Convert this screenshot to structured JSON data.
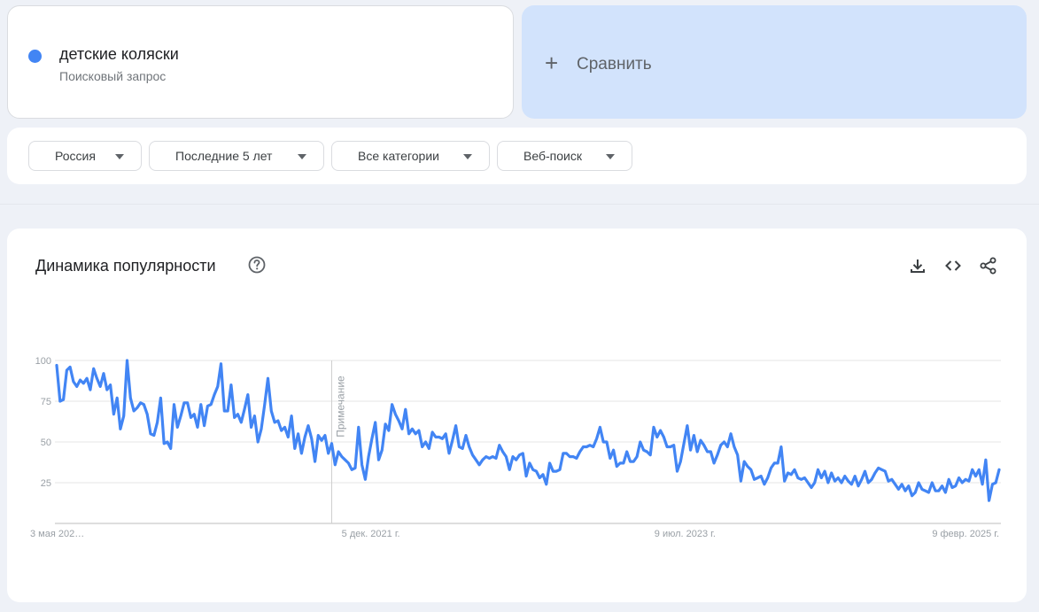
{
  "term": {
    "title": "детские коляски",
    "subtitle": "Поисковый запрос",
    "color": "#4285f4"
  },
  "compare": {
    "label": "Сравнить",
    "icon": "plus-icon"
  },
  "filters": [
    {
      "label": "Россия"
    },
    {
      "label": "Последние 5 лет"
    },
    {
      "label": "Все категории"
    },
    {
      "label": "Веб-поиск"
    }
  ],
  "chart_card": {
    "title": "Динамика популярности",
    "icons": [
      "help-icon",
      "download-icon",
      "embed-icon",
      "share-icon"
    ]
  },
  "chart_data": {
    "type": "line",
    "x_tick_labels": [
      "3 мая 202…",
      "5 дек. 2021 г.",
      "9 июл. 2023 г.",
      "9 февр. 2025 г."
    ],
    "y_ticks": [
      25,
      50,
      75,
      100
    ],
    "ylim": [
      0,
      100
    ],
    "grid": true,
    "annotation": {
      "label": "Примечание",
      "x_index": 82
    },
    "series": [
      {
        "color": "#4285f4",
        "values": [
          97,
          75,
          76,
          94,
          96,
          87,
          84,
          88,
          86,
          89,
          82,
          95,
          89,
          84,
          92,
          82,
          85,
          67,
          77,
          58,
          66,
          100,
          77,
          69,
          71,
          74,
          73,
          67,
          55,
          54,
          62,
          77,
          49,
          50,
          46,
          73,
          59,
          66,
          74,
          74,
          65,
          67,
          59,
          73,
          60,
          72,
          73,
          79,
          84,
          98,
          69,
          69,
          85,
          65,
          67,
          62,
          70,
          79,
          59,
          66,
          50,
          58,
          73,
          89,
          69,
          62,
          63,
          57,
          59,
          53,
          66,
          46,
          55,
          43,
          53,
          60,
          52,
          38,
          54,
          51,
          54,
          43,
          49,
          36,
          44,
          41,
          39,
          37,
          33,
          34,
          59,
          36,
          27,
          41,
          52,
          62,
          39,
          45,
          61,
          57,
          73,
          67,
          63,
          58,
          70,
          55,
          58,
          55,
          57,
          47,
          50,
          46,
          56,
          53,
          53,
          52,
          55,
          43,
          51,
          60,
          47,
          46,
          54,
          47,
          42,
          39,
          36,
          39,
          41,
          40,
          41,
          40,
          48,
          44,
          41,
          33,
          41,
          39,
          42,
          43,
          29,
          37,
          33,
          32,
          28,
          30,
          24,
          37,
          32,
          32,
          33,
          43,
          43,
          41,
          41,
          40,
          44,
          47,
          47,
          48,
          47,
          52,
          59,
          50,
          50,
          40,
          45,
          35,
          37,
          37,
          44,
          38,
          38,
          41,
          50,
          45,
          44,
          42,
          59,
          53,
          57,
          53,
          47,
          47,
          48,
          32,
          38,
          49,
          60,
          45,
          54,
          44,
          51,
          48,
          44,
          44,
          37,
          42,
          48,
          50,
          47,
          55,
          47,
          42,
          26,
          38,
          35,
          33,
          27,
          28,
          29,
          24,
          28,
          34,
          37,
          37,
          47,
          26,
          31,
          30,
          33,
          28,
          27,
          28,
          25,
          22,
          25,
          33,
          28,
          32,
          25,
          31,
          26,
          28,
          25,
          29,
          26,
          24,
          29,
          23,
          27,
          32,
          25,
          27,
          31,
          34,
          33,
          32,
          26,
          27,
          24,
          21,
          24,
          20,
          23,
          17,
          19,
          25,
          21,
          20,
          19,
          25,
          20,
          20,
          23,
          19,
          27,
          22,
          23,
          28,
          25,
          27,
          26,
          33,
          29,
          33,
          24,
          39,
          14,
          24,
          25,
          33
        ]
      }
    ]
  }
}
